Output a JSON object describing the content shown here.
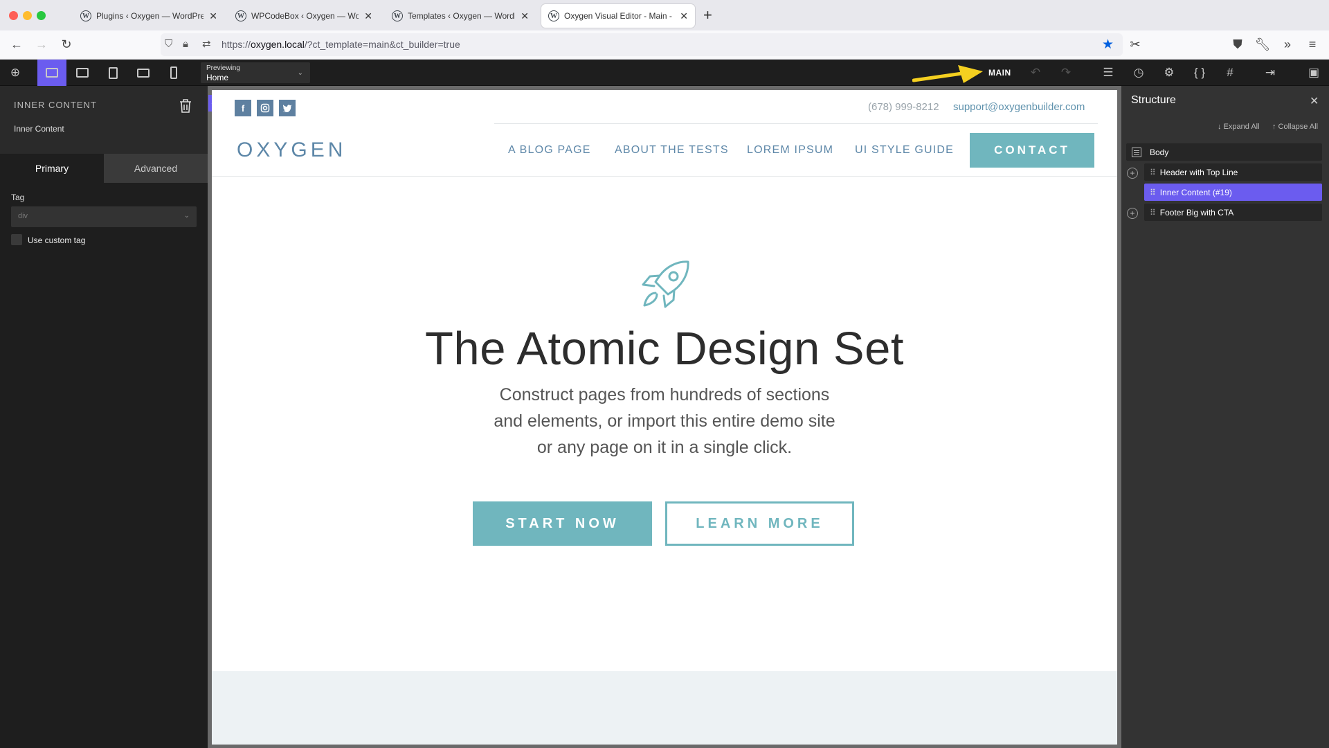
{
  "browser": {
    "tabs": [
      {
        "title": "Plugins ‹ Oxygen — WordPress"
      },
      {
        "title": "WPCodeBox ‹ Oxygen — WordPress"
      },
      {
        "title": "Templates ‹ Oxygen — WordPress"
      },
      {
        "title": "Oxygen Visual Editor - Main - Oxygen"
      }
    ],
    "new_tab_label": "+",
    "url_prefix": "https://",
    "url_host": "oxygen.local",
    "url_path": "/?ct_template=main&ct_builder=true"
  },
  "toolbar": {
    "previewing_label": "Previewing",
    "previewing_value": "Home",
    "template_label": "MAIN",
    "accent_color": "#6b5cef",
    "icons": [
      "add-icon",
      "desktop-icon",
      "laptop-icon",
      "tablet-icon",
      "tablet-landscape-icon",
      "phone-icon",
      "undo-icon",
      "redo-icon",
      "structure-icon",
      "history-icon",
      "settings-icon",
      "code-icon",
      "grid-icon",
      "exit-icon",
      "save-icon"
    ]
  },
  "left_panel": {
    "title": "INNER CONTENT",
    "subtitle": "Inner Content",
    "tabs": [
      "Primary",
      "Advanced"
    ],
    "tag_label": "Tag",
    "tag_value": "div",
    "custom_tag_label": "Use custom tag"
  },
  "page": {
    "social": [
      "f",
      "ig",
      "t"
    ],
    "phone": "(678) 999-8212",
    "email": "support@oxygenbuilder.com",
    "logo": "OXYGEN",
    "menu": [
      "A BLOG PAGE",
      "ABOUT THE TESTS",
      "LOREM IPSUM",
      "UI STYLE GUIDE"
    ],
    "contact": "CONTACT",
    "hero_title": "The Atomic Design Set",
    "hero_lines": [
      "Construct pages from hundreds of sections",
      "and elements, or import this entire demo site",
      "or any page on it in a single click."
    ],
    "cta_primary": "START NOW",
    "cta_secondary": "LEARN MORE",
    "brand_color": "#70b6be",
    "link_color": "#5d87a8"
  },
  "structure": {
    "title": "Structure",
    "expand_all": "↓ Expand All",
    "collapse_all": "↑ Collapse All",
    "items": [
      {
        "label": "Body"
      },
      {
        "label": "Header with Top Line"
      },
      {
        "label": "Inner Content (#19)"
      },
      {
        "label": "Footer Big with CTA"
      }
    ]
  }
}
